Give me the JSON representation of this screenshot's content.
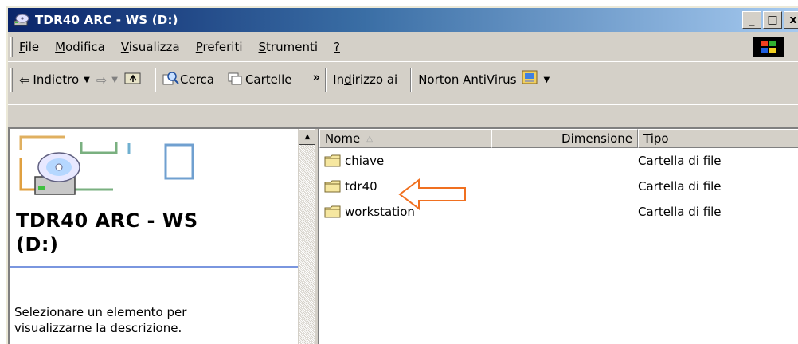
{
  "window": {
    "title": "TDR40 ARC - WS (D:)",
    "buttons": {
      "minimize": "_",
      "maximize": "□",
      "close": "x"
    }
  },
  "menubar": {
    "items": [
      {
        "label": "File",
        "u": "F",
        "rest": "ile"
      },
      {
        "label": "Modifica",
        "u": "M",
        "rest": "odifica"
      },
      {
        "label": "Visualizza",
        "u": "V",
        "rest": "isualizza"
      },
      {
        "label": "Preferiti",
        "u": "P",
        "rest": "referiti"
      },
      {
        "label": "Strumenti",
        "u": "S",
        "rest": "trumenti"
      },
      {
        "label": "?",
        "u": "?",
        "rest": ""
      }
    ]
  },
  "toolbar": {
    "back_label": "Indietro",
    "search_label": "Cerca",
    "folders_label": "Cartelle",
    "more_label": "»",
    "address_pre": "In",
    "address_u": "d",
    "address_post": "irizzo ai",
    "norton_label": "Norton AntiVirus"
  },
  "leftpane": {
    "drive_title_line1": "TDR40 ARC - WS",
    "drive_title_line2": "(D:)",
    "description_line1": "Selezionare un elemento per",
    "description_line2": "visualizzarne la descrizione."
  },
  "list": {
    "columns": {
      "name": "Nome",
      "size": "Dimensione",
      "type": "Tipo"
    },
    "rows": [
      {
        "name": "chiave",
        "size": "",
        "type": "Cartella di file"
      },
      {
        "name": "tdr40",
        "size": "",
        "type": "Cartella di file"
      },
      {
        "name": "workstation",
        "size": "",
        "type": "Cartella di file"
      }
    ]
  },
  "annotation": {
    "arrow_color": "#f07020"
  },
  "colors": {
    "titlebar_start": "#0a246a",
    "titlebar_end": "#a6caf0",
    "face": "#d4d0c8"
  }
}
